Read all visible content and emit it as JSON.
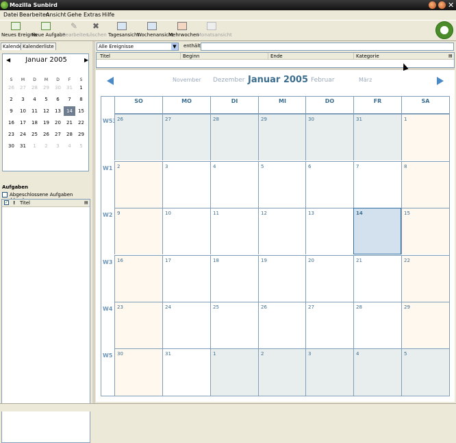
{
  "window": {
    "title": "Mozilla Sunbird"
  },
  "menu": [
    "Datei",
    "Bearbeiten",
    "Ansicht",
    "Gehe",
    "Extras",
    "Hilfe"
  ],
  "toolbar": [
    {
      "label": "Neues Ereignis",
      "icon": "new-event-icon",
      "enabled": true
    },
    {
      "label": "Neue Aufgabe",
      "icon": "new-task-icon",
      "enabled": true
    },
    {
      "label": "Bearbeiten",
      "icon": "pencil-icon",
      "enabled": false
    },
    {
      "label": "Löschen",
      "icon": "delete-x-icon",
      "enabled": false
    },
    {
      "label": "Tagesansicht",
      "icon": "day-view-icon",
      "enabled": true
    },
    {
      "label": "Wochenansicht",
      "icon": "week-view-icon",
      "enabled": true
    },
    {
      "label": "Mehrwochen",
      "icon": "multiweek-view-icon",
      "enabled": true
    },
    {
      "label": "Monatsansicht",
      "icon": "month-view-icon",
      "enabled": false
    }
  ],
  "left": {
    "tabs": [
      "Kalender",
      "Kalenderliste"
    ],
    "minical": {
      "title": "Januar 2005",
      "dow": [
        "S",
        "M",
        "D",
        "M",
        "D",
        "F",
        "S"
      ],
      "weeks": [
        [
          "26",
          "27",
          "28",
          "29",
          "30",
          "31",
          "1"
        ],
        [
          "2",
          "3",
          "4",
          "5",
          "6",
          "7",
          "8"
        ],
        [
          "9",
          "10",
          "11",
          "12",
          "13",
          "14",
          "15"
        ],
        [
          "16",
          "17",
          "18",
          "19",
          "20",
          "21",
          "22"
        ],
        [
          "23",
          "24",
          "25",
          "26",
          "27",
          "28",
          "29"
        ],
        [
          "30",
          "31",
          "1",
          "2",
          "3",
          "4",
          "5"
        ]
      ],
      "today": "14"
    },
    "tasks_label": "Aufgaben",
    "hide_completed": "Abgeschlossene Aufgaben ausblenden",
    "task_col_flag": "!",
    "task_col_title": "Titel"
  },
  "filter": {
    "selected": "Alle Ereignisse",
    "contains_label": "enthält",
    "search_value": ""
  },
  "eventlist": {
    "columns": [
      "Titel",
      "Beginn",
      "Ende",
      "Kategorie"
    ]
  },
  "month": {
    "prev2": "November",
    "prev1": "Dezember",
    "current": "Januar 2005",
    "next1": "Februar",
    "next2": "März",
    "dow": [
      "SO",
      "MO",
      "DI",
      "MI",
      "DO",
      "FR",
      "SA"
    ],
    "week_numbers": [
      "W53",
      "W1",
      "W2",
      "W3",
      "W4",
      "W5"
    ],
    "weeks": [
      [
        "26",
        "27",
        "28",
        "29",
        "30",
        "31",
        "1"
      ],
      [
        "2",
        "3",
        "4",
        "5",
        "6",
        "7",
        "8"
      ],
      [
        "9",
        "10",
        "11",
        "12",
        "13",
        "14",
        "15"
      ],
      [
        "16",
        "17",
        "18",
        "19",
        "20",
        "21",
        "22"
      ],
      [
        "23",
        "24",
        "25",
        "26",
        "27",
        "28",
        "29"
      ],
      [
        "30",
        "31",
        "1",
        "2",
        "3",
        "4",
        "5"
      ]
    ],
    "selected": "14"
  }
}
